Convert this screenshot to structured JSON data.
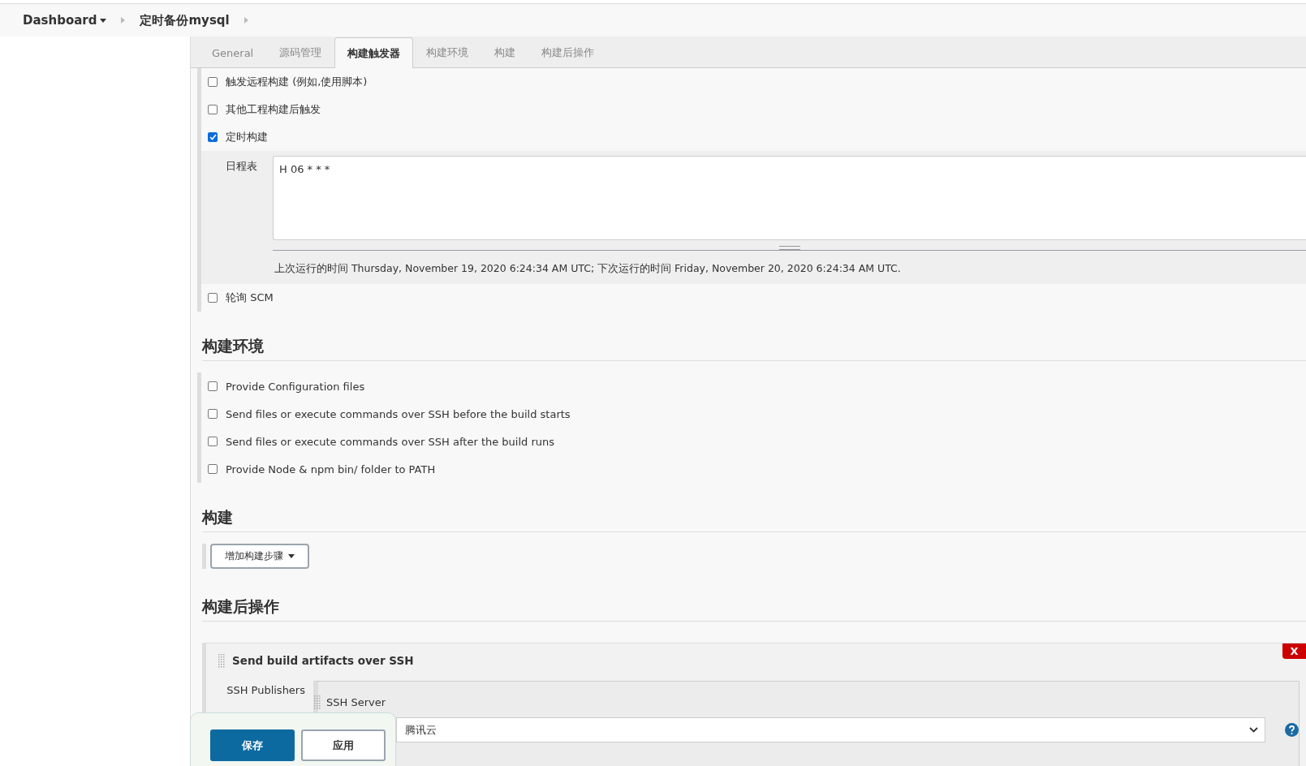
{
  "breadcrumbs": [
    {
      "label": "Dashboard",
      "dropdown": true
    },
    {
      "label": "定时备份mysql",
      "dropdown": false
    }
  ],
  "tabs": [
    {
      "label": "General",
      "selected": false
    },
    {
      "label": "源码管理",
      "selected": false
    },
    {
      "label": "构建触发器",
      "selected": true
    },
    {
      "label": "构建环境",
      "selected": false
    },
    {
      "label": "构建",
      "selected": false
    },
    {
      "label": "构建后操作",
      "selected": false
    }
  ],
  "triggers": [
    {
      "label": "触发远程构建 (例如,使用脚本)",
      "checked": false
    },
    {
      "label": "其他工程构建后触发",
      "checked": false
    },
    {
      "label": "定时构建",
      "checked": true,
      "schedule": {
        "label": "日程表",
        "value": "H 06 * * *",
        "note": "上次运行的时间 Thursday, November 19, 2020 6:24:34 AM UTC; 下次运行的时间 Friday, November 20, 2020 6:24:34 AM UTC."
      }
    },
    {
      "label": "轮询 SCM",
      "checked": false
    }
  ],
  "build_environment": {
    "title": "构建环境",
    "options": [
      {
        "label": "Provide Configuration files",
        "checked": false
      },
      {
        "label": "Send files or execute commands over SSH before the build starts",
        "checked": false
      },
      {
        "label": "Send files or execute commands over SSH after the build runs",
        "checked": false
      },
      {
        "label": "Provide Node & npm bin/ folder to PATH",
        "checked": false
      }
    ]
  },
  "build": {
    "title": "构建",
    "add_step_button": "增加构建步骤"
  },
  "post_build": {
    "title": "构建后操作",
    "step": {
      "title": "Send build artifacts over SSH",
      "remove_button": "X",
      "publishers_label": "SSH Publishers",
      "server_label": "SSH Server",
      "server_name": "腾讯云"
    }
  },
  "actions": {
    "save": "保存",
    "apply": "应用"
  }
}
